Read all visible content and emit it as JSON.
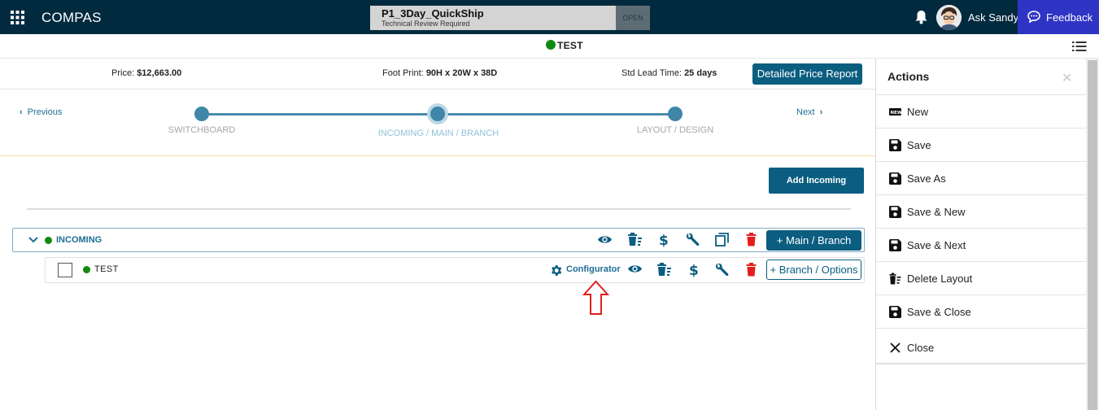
{
  "app": {
    "title": "COMPAS"
  },
  "document": {
    "name": "P1_3Day_QuickShip",
    "subtitle": "Technical Review Required",
    "status": "OPEN"
  },
  "user": {
    "name": "Ask Sandy"
  },
  "feedback": {
    "label": "Feedback"
  },
  "status_bar": {
    "name": "TEST",
    "indicator_color": "#0e8a0e"
  },
  "info": {
    "price_label": "Price:",
    "price_value": "$12,663.00",
    "footprint_label": "Foot Print:",
    "footprint_value": "90H x 20W x 38D",
    "leadtime_label": "Std Lead Time:",
    "leadtime_value": "25 days",
    "report_button": "Detailed Price Report"
  },
  "stepper": {
    "previous": "Previous",
    "next": "Next",
    "steps": [
      {
        "label": "SWITCHBOARD",
        "active": false
      },
      {
        "label": "INCOMING / MAIN / BRANCH",
        "active": true
      },
      {
        "label": "LAYOUT / DESIGN",
        "active": false
      }
    ]
  },
  "toolbar": {
    "add_incoming": "Add Incoming"
  },
  "incoming_row": {
    "label": "INCOMING",
    "add_button": "+ Main / Branch"
  },
  "branch_row": {
    "label": "TEST",
    "configurator": "Configurator",
    "add_button": "+ Branch / Options"
  },
  "actions": {
    "title": "Actions",
    "items": [
      {
        "label": "New",
        "icon": "new-icon"
      },
      {
        "label": "Save",
        "icon": "save-icon"
      },
      {
        "label": "Save As",
        "icon": "save-icon"
      },
      {
        "label": "Save & New",
        "icon": "save-icon"
      },
      {
        "label": "Save & Next",
        "icon": "save-icon"
      },
      {
        "label": "Delete Layout",
        "icon": "delete-layout-icon"
      },
      {
        "label": "Save & Close",
        "icon": "save-icon"
      },
      {
        "label": "Close",
        "icon": "close-icon"
      }
    ]
  },
  "colors": {
    "header_bg": "#022a3f",
    "brand_blue": "#0b5e80",
    "feedback_bg": "#2f34c4",
    "delete_red": "#e51c1c",
    "annotation_red": "#e02020"
  }
}
